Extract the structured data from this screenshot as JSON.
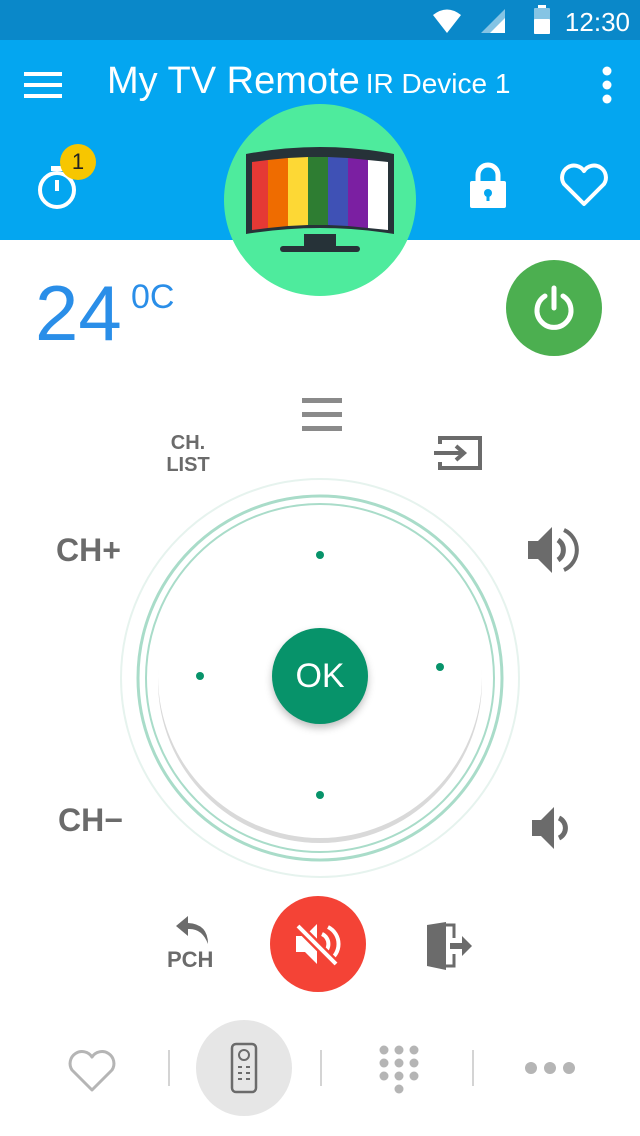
{
  "status_bar": {
    "time": "12:30",
    "icons": [
      "wifi-icon",
      "signal-icon",
      "battery-icon"
    ]
  },
  "app_bar": {
    "title": "My TV Remote",
    "subtitle": "IR Device 1",
    "timer_badge": "1",
    "icons": [
      "menu-icon",
      "more-vert-icon",
      "timer-icon",
      "lock-icon",
      "heart-icon",
      "tv-icon"
    ]
  },
  "temperature": {
    "value": "24",
    "unit": "0C"
  },
  "remote": {
    "ch_list_line1": "CH.",
    "ch_list_line2": "LIST",
    "ch_up": "CH+",
    "ch_down": "CH−",
    "ok": "OK",
    "pch": "PCH"
  },
  "bottom_nav": {
    "items": [
      "favorites",
      "remote",
      "keypad",
      "more"
    ]
  },
  "colors": {
    "status_bar": "#0a88c9",
    "app_bar": "#04a6f0",
    "tv_circle": "#4eeb9d",
    "temperature": "#2a8ee8",
    "power": "#4caf50",
    "ok": "#07936a",
    "mute": "#f44336",
    "dpad_ring": "#a9dcc9"
  }
}
